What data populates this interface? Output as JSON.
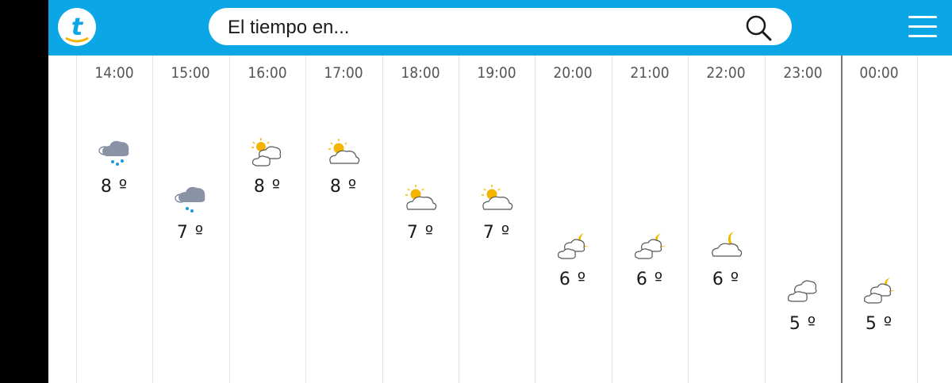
{
  "app": {
    "logo_letter": "t"
  },
  "search": {
    "label": "El tiempo en..."
  },
  "colors": {
    "brand": "#0aa6e6",
    "sun": "#f5b400",
    "rain_cloud": "#8a92a6",
    "rain_drop": "#1e9ad6",
    "moon": "#f5b400"
  },
  "hours": [
    {
      "time": "14:00",
      "temp": "8 º",
      "icon": "rain-cloud-icon"
    },
    {
      "time": "15:00",
      "temp": "7 º",
      "icon": "light-rain-cloud-icon"
    },
    {
      "time": "16:00",
      "temp": "8 º",
      "icon": "sun-clouds-icon"
    },
    {
      "time": "17:00",
      "temp": "8 º",
      "icon": "sun-cloud-icon"
    },
    {
      "time": "18:00",
      "temp": "7 º",
      "icon": "sun-cloud-icon"
    },
    {
      "time": "19:00",
      "temp": "7 º",
      "icon": "sun-cloud-icon"
    },
    {
      "time": "20:00",
      "temp": "6 º",
      "icon": "moon-clouds-icon"
    },
    {
      "time": "21:00",
      "temp": "6 º",
      "icon": "moon-clouds-icon"
    },
    {
      "time": "22:00",
      "temp": "6 º",
      "icon": "moon-cloud-icon"
    },
    {
      "time": "23:00",
      "temp": "5 º",
      "icon": "clouds-icon"
    },
    {
      "time": "00:00",
      "temp": "5 º",
      "icon": "moon-clouds-icon"
    }
  ]
}
